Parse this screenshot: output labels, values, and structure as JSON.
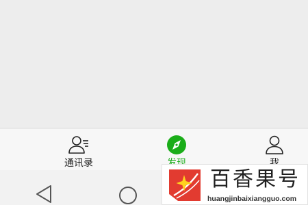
{
  "tab_bar": {
    "items": [
      {
        "label": "通讯录",
        "icon": "contacts-icon",
        "active": false
      },
      {
        "label": "发现",
        "icon": "compass-icon",
        "active": true
      },
      {
        "label": "我",
        "icon": "person-icon",
        "active": false
      }
    ]
  },
  "system_nav": {
    "buttons": [
      "back-triangle-icon",
      "home-circle-icon",
      "recent-apps-square-icon"
    ]
  },
  "watermark": {
    "title": "百香果号",
    "url": "huangjinbaixiangguo.com"
  },
  "colors": {
    "accent": "#1aad19",
    "background": "#ededed",
    "tab_bar": "#f7f7f7",
    "logo_red": "#e23b30"
  }
}
